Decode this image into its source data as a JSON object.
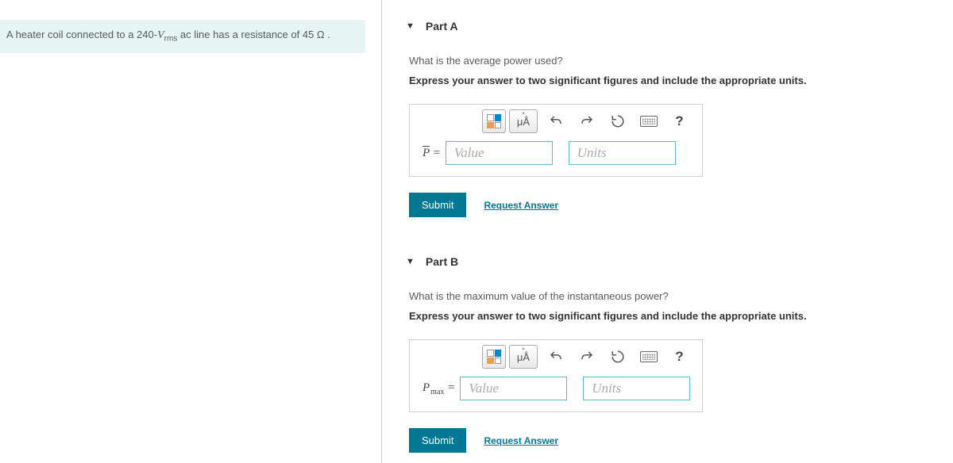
{
  "problem": {
    "text_before": "A heater coil connected to a 240-",
    "voltage_sym": "V",
    "voltage_sub": "rms",
    "text_mid": " ac line has a resistance of 45 ",
    "ohm": "Ω",
    "text_after": " ."
  },
  "parts": [
    {
      "title": "Part A",
      "question": "What is the average power used?",
      "instruction": "Express your answer to two significant figures and include the appropriate units.",
      "var_html": "Pbar",
      "units_tool": "μÅ",
      "value_placeholder": "Value",
      "units_placeholder": "Units",
      "submit": "Submit",
      "request": "Request Answer",
      "help": "?"
    },
    {
      "title": "Part B",
      "question": "What is the maximum value of the instantaneous power?",
      "instruction": "Express your answer to two significant figures and include the appropriate units.",
      "var_html": "Pmax",
      "units_tool": "μÅ",
      "value_placeholder": "Value",
      "units_placeholder": "Units",
      "submit": "Submit",
      "request": "Request Answer",
      "help": "?"
    }
  ]
}
